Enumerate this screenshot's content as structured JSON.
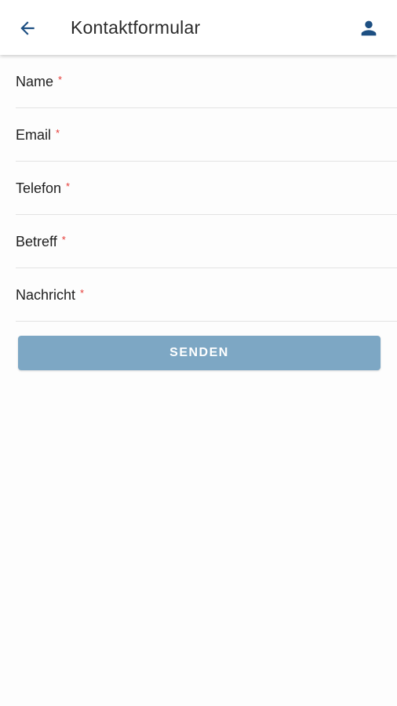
{
  "header": {
    "title": "Kontaktformular",
    "back_icon": "arrow-left-icon",
    "account_icon": "person-icon",
    "accent_color": "#1d4f82"
  },
  "form": {
    "required_mark": "*",
    "fields": [
      {
        "label": "Name"
      },
      {
        "label": "Email"
      },
      {
        "label": "Telefon"
      },
      {
        "label": "Betreff"
      },
      {
        "label": "Nachricht"
      }
    ],
    "submit_label": "SENDEN",
    "submit_color": "#7da7c4"
  }
}
